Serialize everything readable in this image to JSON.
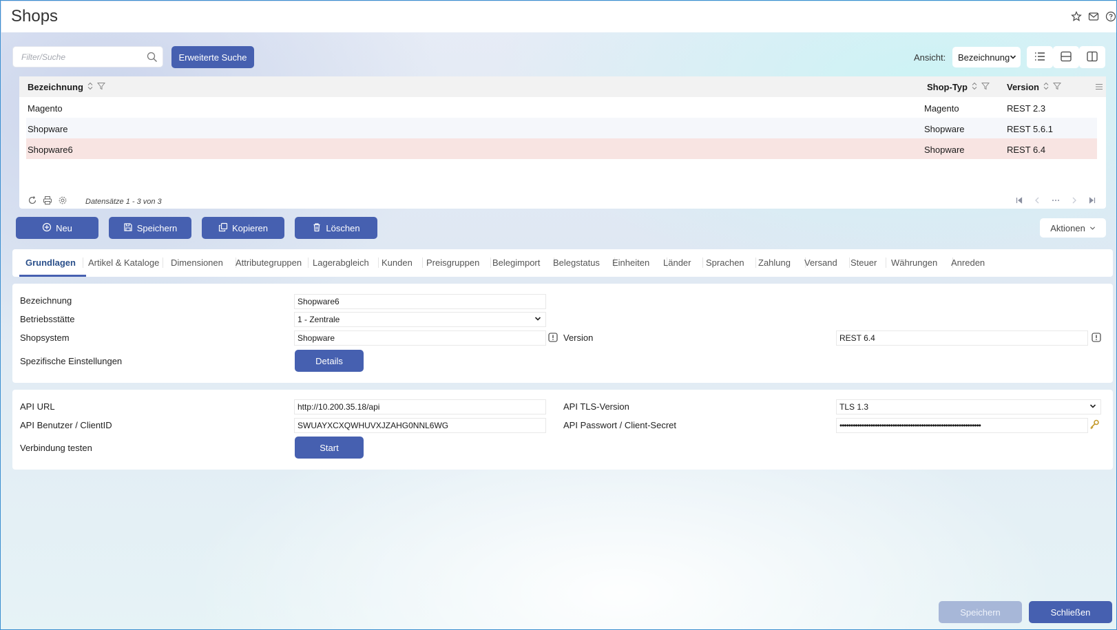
{
  "window": {
    "title": "Shops"
  },
  "toolbar": {
    "search_placeholder": "Filter/Suche",
    "extended_search_label": "Erweiterte Suche",
    "view_label": "Ansicht:",
    "view_value": "Bezeichnung"
  },
  "grid": {
    "columns": [
      "Bezeichnung",
      "Shop-Typ",
      "Version"
    ],
    "rows": [
      {
        "name": "Magento",
        "type": "Magento",
        "version": "REST 2.3"
      },
      {
        "name": "Shopware",
        "type": "Shopware",
        "version": "REST 5.6.1"
      },
      {
        "name": "Shopware6",
        "type": "Shopware",
        "version": "REST 6.4"
      }
    ],
    "record_count": "Datensätze 1 - 3 von 3",
    "selected_row": 2
  },
  "actions": {
    "new": "Neu",
    "save": "Speichern",
    "copy": "Kopieren",
    "delete": "Löschen",
    "more": "Aktionen"
  },
  "tabs": [
    "Grundlagen",
    "Artikel & Kataloge",
    "Dimensionen",
    "Attributegruppen",
    "Lagerabgleich",
    "Kunden",
    "Preisgruppen",
    "Belegimport",
    "Belegstatus",
    "Einheiten",
    "Länder",
    "Sprachen",
    "Zahlung",
    "Versand",
    "Steuer",
    "Währungen",
    "Anreden"
  ],
  "active_tab": "Grundlagen",
  "general": {
    "name_label": "Bezeichnung",
    "name_value": "Shopware6",
    "site_label": "Betriebsstätte",
    "site_value": "1 - Zentrale",
    "system_label": "Shopsystem",
    "system_value": "Shopware",
    "version_label": "Version",
    "version_value": "REST 6.4",
    "specific_label": "Spezifische Einstellungen",
    "details_button": "Details"
  },
  "api": {
    "url_label": "API URL",
    "url_value": "http://10.200.35.18/api",
    "tls_label": "API TLS-Version",
    "tls_value": "TLS 1.3",
    "user_label": "API Benutzer / ClientID",
    "user_value": "SWUAYXCXQWHUVXJZAHG0NNL6WG",
    "password_label": "API Passwort / Client-Secret",
    "password_value": "••••••••••••••••••••••••••••••••••••••••••••••••••••••••••••••••",
    "test_label": "Verbindung testen",
    "start_button": "Start"
  },
  "footer": {
    "save": "Speichern",
    "close": "Schließen"
  },
  "colors": {
    "primary": "#4660b0",
    "selected_row": "#f8e4e2",
    "disabled_button": "#a7b7d8"
  }
}
